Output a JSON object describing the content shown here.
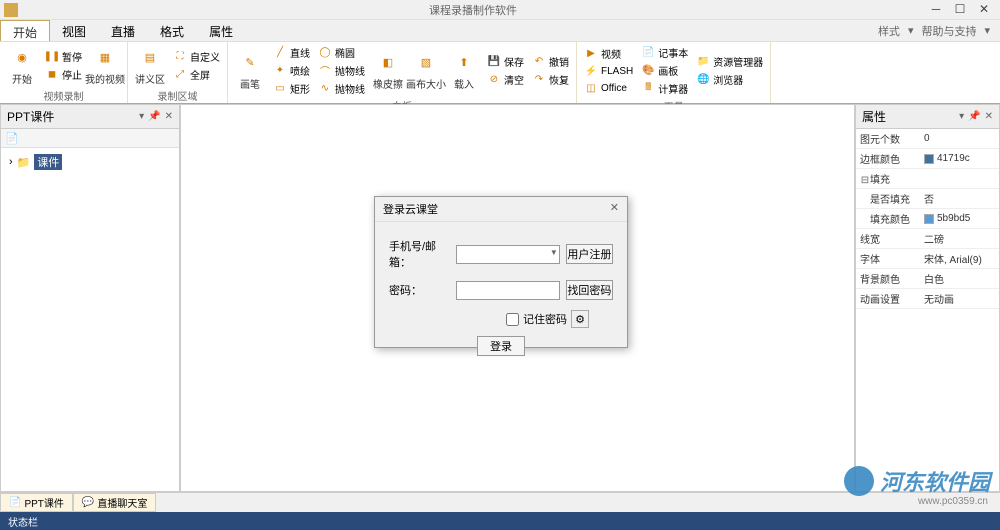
{
  "title": "课程录播制作软件",
  "menubar": {
    "tabs": [
      "开始",
      "视图",
      "直播",
      "格式",
      "属性"
    ],
    "right": {
      "style": "样式",
      "help": "帮助与支持"
    }
  },
  "ribbon": {
    "groups": {
      "record": {
        "label": "视频录制",
        "start": "开始",
        "pause": "暂停",
        "stop": "停止",
        "myvideo": "我的视频"
      },
      "area": {
        "label": "录制区域",
        "lecture": "讲义区",
        "custom": "自定义",
        "fullscreen": "全屏"
      },
      "whiteboard": {
        "label": "白板",
        "brush": "画笔",
        "line": "直线",
        "spray": "喷绘",
        "rect": "矩形",
        "oval": "椭圆",
        "parabola": "抛物线",
        "parabola2": "抛物线",
        "eraser": "橡皮擦",
        "canvasSize": "画布大小",
        "import": "载入",
        "save": "保存",
        "clear": "清空",
        "undo": "撤销",
        "redo": "恢复"
      },
      "tools": {
        "label": "工具",
        "video": "视频",
        "flash": "FLASH",
        "office": "Office",
        "notepad": "记事本",
        "drawboard": "画板",
        "calculator": "计算器",
        "resmgr": "资源管理器",
        "browser": "浏览器"
      }
    }
  },
  "leftPanel": {
    "title": "PPT课件",
    "treeItem": "课件"
  },
  "rightPanel": {
    "title": "属性",
    "rows": {
      "primCount": {
        "label": "图元个数",
        "value": "0"
      },
      "borderColor": {
        "label": "边框颜色",
        "value": "41719c",
        "swatch": "#41719c"
      },
      "fill": {
        "label": "填充"
      },
      "hasFill": {
        "label": "是否填充",
        "value": "否"
      },
      "fillColor": {
        "label": "填充颜色",
        "value": "5b9bd5",
        "swatch": "#5b9bd5"
      },
      "lineWidth": {
        "label": "线宽",
        "value": "二磅"
      },
      "font": {
        "label": "字体",
        "value": "宋体, Arial(9)"
      },
      "bgColor": {
        "label": "背景颜色",
        "value": "白色"
      },
      "anim": {
        "label": "动画设置",
        "value": "无动画"
      }
    }
  },
  "dialog": {
    "title": "登录云课堂",
    "phoneLabel": "手机号/邮箱：",
    "passLabel": "密码：",
    "register": "用户注册",
    "findPass": "找回密码",
    "remember": "记住密码",
    "login": "登录"
  },
  "bottomTabs": {
    "tab1": "PPT课件",
    "tab2": "直播聊天室"
  },
  "statusbar": "状态栏",
  "watermark": {
    "text": "河东软件园",
    "url": "www.pc0359.cn"
  }
}
